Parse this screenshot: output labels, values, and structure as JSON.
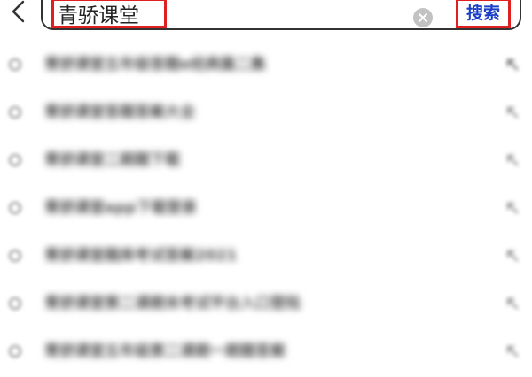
{
  "search": {
    "back_icon": "chevron-left-icon",
    "query": "青骄课堂",
    "clear_icon": "clear-circle-icon",
    "button_label": "搜索"
  },
  "colors": {
    "highlight_border": "#e02020",
    "search_button_text": "#1a3fc8",
    "search_box_border": "#333333"
  },
  "suggestions": [
    {
      "text": "青骄课堂五年级答题e经典篇二集",
      "icon": "search-icon",
      "action_icon": "fill-arrow-icon"
    },
    {
      "text": "青骄课堂答题答案大全",
      "icon": "search-icon",
      "action_icon": "fill-arrow-icon"
    },
    {
      "text": "青骄课堂二期题下载",
      "icon": "search-icon",
      "action_icon": "fill-arrow-icon"
    },
    {
      "text": "青骄课堂app下载登录",
      "icon": "search-icon",
      "action_icon": "fill-arrow-icon"
    },
    {
      "text": "青骄课堂题库考试答案2021",
      "icon": "search-icon",
      "action_icon": "fill-arrow-icon"
    },
    {
      "text": "青骄课堂第二课期末考试平台入口登陆",
      "icon": "search-icon",
      "action_icon": "fill-arrow-icon"
    },
    {
      "text": "青骄课堂五年级第二课期一期题答案",
      "icon": "search-icon",
      "action_icon": "fill-arrow-icon"
    }
  ]
}
